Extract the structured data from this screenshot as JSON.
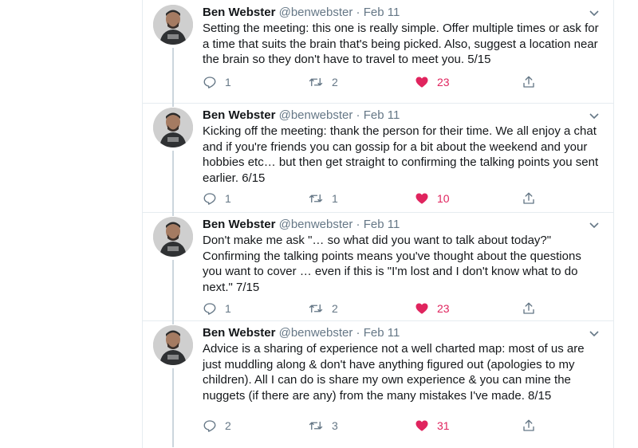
{
  "tweets": [
    {
      "name": "Ben Webster",
      "handle": "@benwebster",
      "separator": "·",
      "date": "Feb 11",
      "text": "Setting the meeting: this one is really simple. Offer multiple times or ask for a time that suits the brain that's being picked. Also, suggest a location near the brain so they don't have to travel to meet you. 5/15",
      "replies": "1",
      "retweets": "2",
      "likes": "23"
    },
    {
      "name": "Ben Webster",
      "handle": "@benwebster",
      "separator": "·",
      "date": "Feb 11",
      "text": "Kicking off the meeting: thank the person for their time. We all enjoy a chat and if you're friends you can gossip for a bit about the weekend and your hobbies etc… but then get straight to confirming the talking points you sent earlier.  6/15",
      "replies": "1",
      "retweets": "1",
      "likes": "10"
    },
    {
      "name": "Ben Webster",
      "handle": "@benwebster",
      "separator": "·",
      "date": "Feb 11",
      "text": "Don't make me ask \"… so what did you want to talk about today?\" Confirming the talking points means you've thought about the questions you want to cover … even if this is \"I'm lost and I don't know what to do next.\" 7/15",
      "replies": "1",
      "retweets": "2",
      "likes": "23"
    },
    {
      "name": "Ben Webster",
      "handle": "@benwebster",
      "separator": "·",
      "date": "Feb 11",
      "text": "Advice is a sharing of experience not a well charted map: most of us are just muddling along & don't have anything figured out (apologies to my children). All I can do is share my own experience & you can mine the nuggets (if there are any) from the many mistakes I've made. 8/15",
      "replies": "2",
      "retweets": "3",
      "likes": "31"
    }
  ],
  "icons": {
    "reply": "reply-icon",
    "retweet": "retweet-icon",
    "like": "heart-icon",
    "share": "share-icon",
    "caret": "chevron-down-icon"
  },
  "colors": {
    "text": "#14171a",
    "secondary": "#657786",
    "like": "#e0245e",
    "thread_line": "#ccd6dd",
    "border": "#e6ecf0"
  }
}
